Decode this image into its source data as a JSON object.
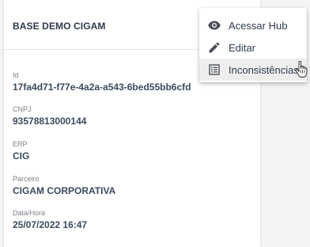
{
  "card": {
    "title": "BASE DEMO CIGAM",
    "fields": [
      {
        "label": "Id",
        "value": "17fa4d71-f77e-4a2a-a543-6bed55bb6cfd"
      },
      {
        "label": "CNPJ",
        "value": "93578813000144"
      },
      {
        "label": "ERP",
        "value": "CIG"
      },
      {
        "label": "Parceiro",
        "value": "CIGAM CORPORATIVA"
      },
      {
        "label": "Data/Hora",
        "value": "25/07/2022 16:47"
      }
    ]
  },
  "menu": {
    "items": [
      {
        "label": "Acessar Hub",
        "icon": "eye-icon"
      },
      {
        "label": "Editar",
        "icon": "pencil-icon"
      },
      {
        "label": "Inconsistências",
        "icon": "list-icon",
        "hovered": true
      }
    ]
  },
  "colors": {
    "title": "#2e3b4e",
    "label": "#7a7f87",
    "value": "#3b4a5e",
    "icon": "#4a4f57",
    "hover_bg": "#eeeeee"
  }
}
